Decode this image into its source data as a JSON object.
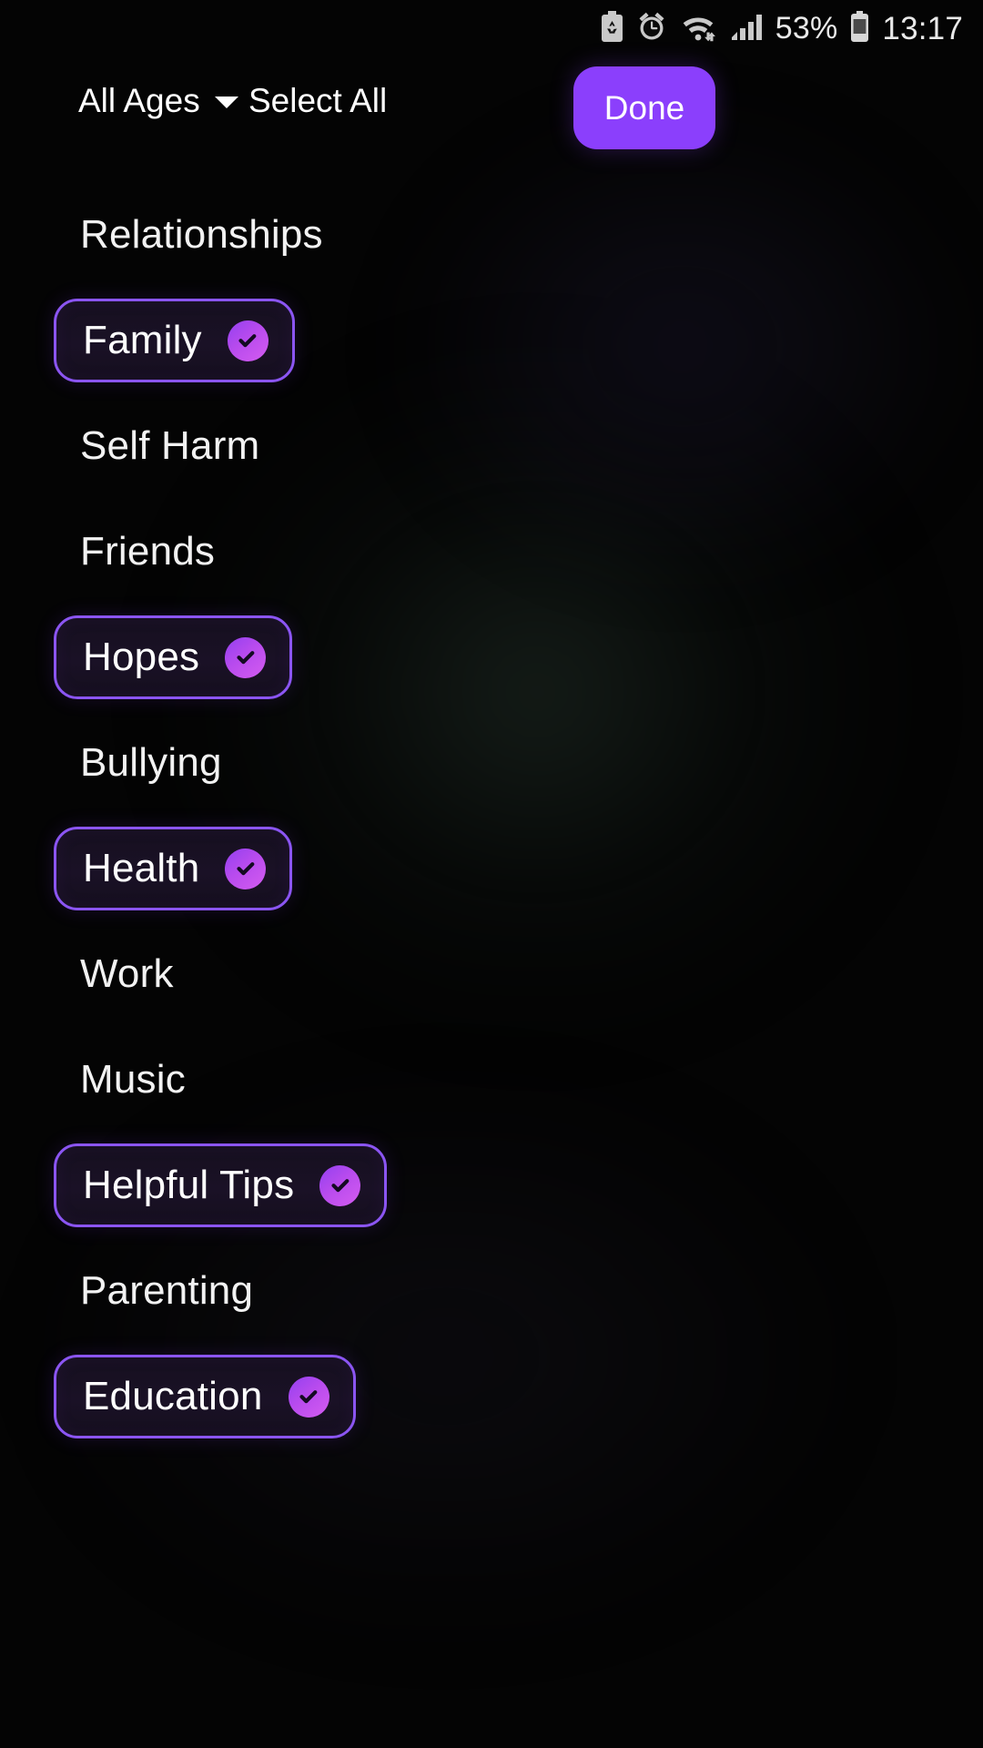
{
  "status_bar": {
    "icons": [
      "battery-saver-icon",
      "alarm-icon",
      "wifi-icon",
      "cellular-signal-icon"
    ],
    "battery_percent": "53%",
    "battery_icon": "battery-icon",
    "time": "13:17"
  },
  "header": {
    "age_filter_label": "All Ages",
    "age_filter_caret": "chevron-down-icon",
    "select_all_label": "Select All",
    "done_label": "Done",
    "accent_color": "#8b3ffc"
  },
  "colors": {
    "background": "#040404",
    "chip_border": "#8b55f2",
    "chip_fill": "#1a1126",
    "badge_gradient_start": "#9340f0",
    "badge_gradient_end": "#d45cf0",
    "text": "#ffffff"
  },
  "topics": [
    {
      "label": "Relationships",
      "selected": false
    },
    {
      "label": "Family",
      "selected": true
    },
    {
      "label": "Self Harm",
      "selected": false
    },
    {
      "label": "Friends",
      "selected": false
    },
    {
      "label": "Hopes",
      "selected": true
    },
    {
      "label": "Bullying",
      "selected": false
    },
    {
      "label": "Health",
      "selected": true
    },
    {
      "label": "Work",
      "selected": false
    },
    {
      "label": "Music",
      "selected": false
    },
    {
      "label": "Helpful Tips",
      "selected": true
    },
    {
      "label": "Parenting",
      "selected": false
    },
    {
      "label": "Education",
      "selected": true
    }
  ]
}
